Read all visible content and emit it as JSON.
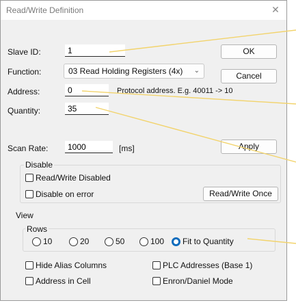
{
  "window": {
    "title": "Read/Write Definition",
    "close_glyph": "✕"
  },
  "slave_id": {
    "label": "Slave ID:",
    "value": "1"
  },
  "function": {
    "label": "Function:",
    "value": "03 Read Holding Registers (4x)"
  },
  "address": {
    "label": "Address:",
    "value": "0",
    "hint": "Protocol address. E.g. 40011 -> 10"
  },
  "quantity": {
    "label": "Quantity:",
    "value": "35"
  },
  "scan_rate": {
    "label": "Scan Rate:",
    "value": "1000",
    "unit": "[ms]"
  },
  "buttons": {
    "ok": "OK",
    "cancel": "Cancel",
    "apply": "Apply",
    "read_write_once": "Read/Write Once"
  },
  "disable": {
    "title": "Disable",
    "read_write_disabled": "Read/Write Disabled",
    "disable_on_error": "Disable on error"
  },
  "view": {
    "title": "View",
    "rows_title": "Rows",
    "rows": [
      "10",
      "20",
      "50",
      "100",
      "Fit to Quantity"
    ],
    "selected_row": "Fit to Quantity",
    "hide_alias_columns": "Hide Alias Columns",
    "address_in_cell": "Address in Cell",
    "plc_addresses": "PLC Addresses (Base 1)",
    "enron_daniel": "Enron/Daniel Mode"
  },
  "colors": {
    "callout_line": "#f2d36b",
    "radio_accent": "#0f6cbd"
  }
}
